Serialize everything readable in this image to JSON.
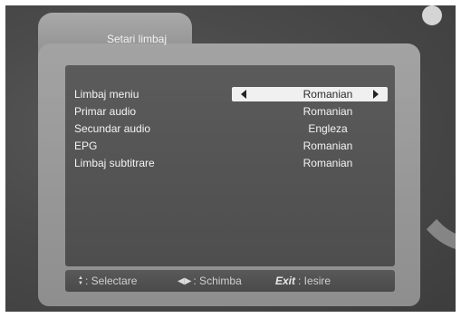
{
  "window": {
    "title": "Setari limbaj"
  },
  "menu": {
    "items": [
      {
        "label": "Limbaj meniu",
        "value": "Romanian",
        "selected": true
      },
      {
        "label": "Primar audio",
        "value": "Romanian"
      },
      {
        "label": "Secundar audio",
        "value": "Engleza"
      },
      {
        "label": "EPG",
        "value": "Romanian"
      },
      {
        "label": "Limbaj subtitrare",
        "value": "Romanian"
      }
    ]
  },
  "footer": {
    "select": {
      "icon": "up-down-arrows-icon",
      "label": ": Selectare"
    },
    "change": {
      "icon": "left-right-arrows-icon",
      "label": ": Schimba"
    },
    "exit": {
      "icon_text": "Exit",
      "label": ": Iesire"
    }
  },
  "colors": {
    "selection": "#f0f0f0",
    "content_bg": "#545454",
    "frame_bg": "#9a9a9a"
  }
}
